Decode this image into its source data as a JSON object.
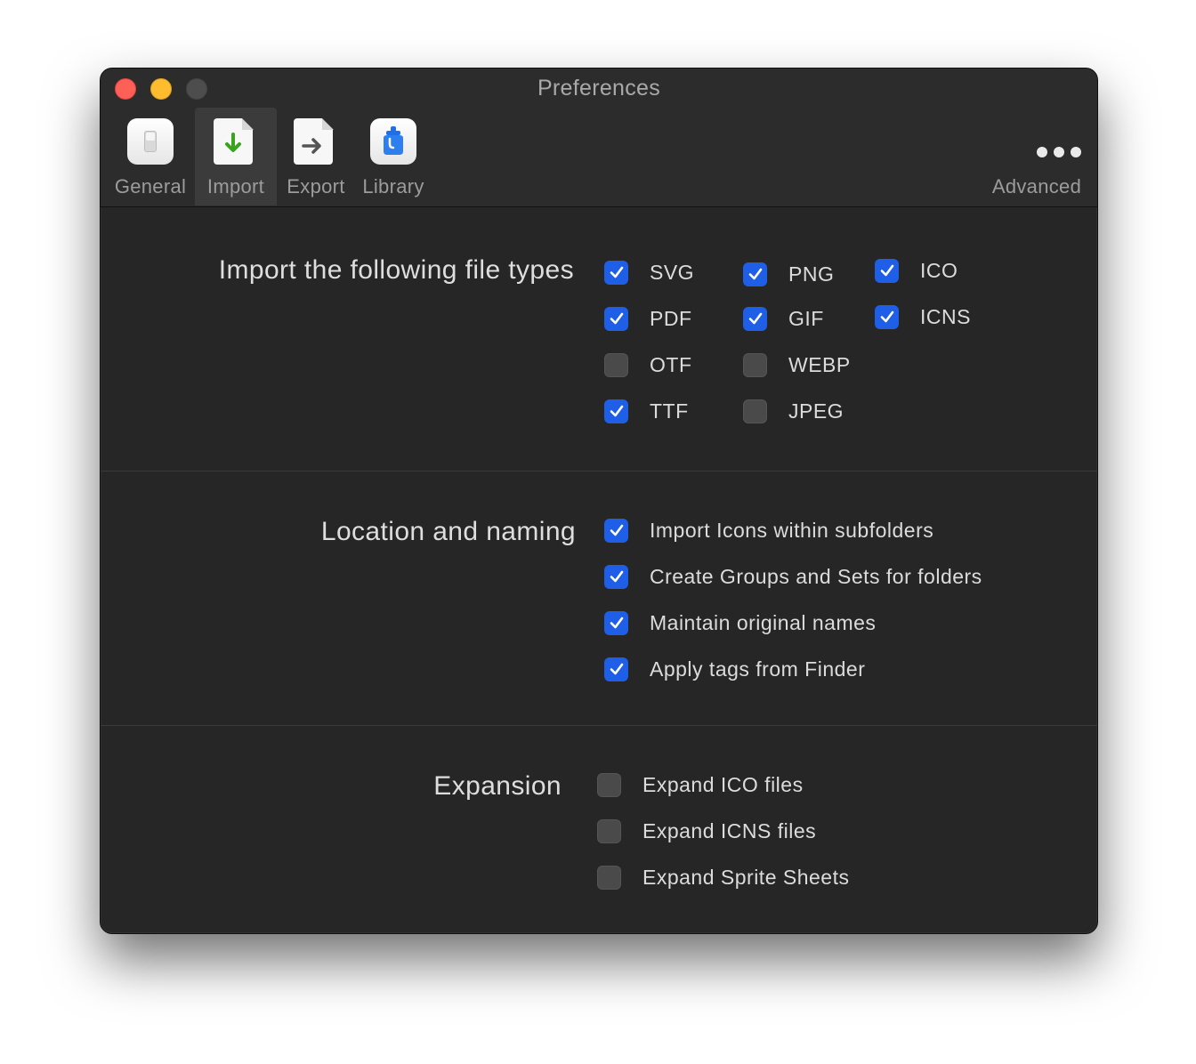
{
  "window": {
    "title": "Preferences"
  },
  "toolbar": {
    "general": "General",
    "import": "Import",
    "export": "Export",
    "library": "Library",
    "advanced": "Advanced",
    "selected": "import"
  },
  "file_types": {
    "label": "Import the following file types",
    "items": [
      {
        "label": "SVG",
        "checked": true
      },
      {
        "label": "PDF",
        "checked": true
      },
      {
        "label": "OTF",
        "checked": false
      },
      {
        "label": "TTF",
        "checked": true
      },
      {
        "label": "PNG",
        "checked": true
      },
      {
        "label": "GIF",
        "checked": true
      },
      {
        "label": "WEBP",
        "checked": false
      },
      {
        "label": "JPEG",
        "checked": false
      },
      {
        "label": "ICO",
        "checked": true
      },
      {
        "label": "ICNS",
        "checked": true
      }
    ]
  },
  "location": {
    "label": "Location and naming",
    "items": [
      {
        "label": "Import Icons within subfolders",
        "checked": true
      },
      {
        "label": "Create Groups and Sets for folders",
        "checked": true
      },
      {
        "label": "Maintain original names",
        "checked": true
      },
      {
        "label": "Apply tags from Finder",
        "checked": true
      }
    ]
  },
  "expansion": {
    "label": "Expansion",
    "items": [
      {
        "label": "Expand ICO files",
        "checked": false
      },
      {
        "label": "Expand ICNS files",
        "checked": false
      },
      {
        "label": "Expand Sprite Sheets",
        "checked": false
      }
    ]
  },
  "colors": {
    "accent": "#1f5fe8",
    "window_bg": "#262626",
    "close": "#fe5f57",
    "minimize": "#febc2e"
  }
}
